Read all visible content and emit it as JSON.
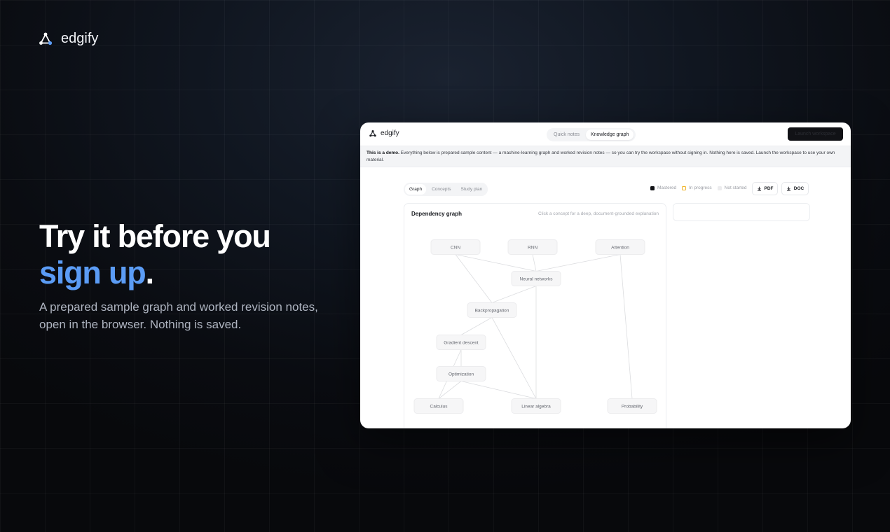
{
  "brand": {
    "name": "edgify"
  },
  "hero": {
    "title_line1": "Try it before you",
    "title_accent": "sign up",
    "title_period": ".",
    "subtitle": "A prepared sample graph and worked revision notes, open in the browser. Nothing is saved."
  },
  "demo": {
    "brand": "edgify",
    "tabs": [
      {
        "label": "Quick notes",
        "active": false
      },
      {
        "label": "Knowledge graph",
        "active": true
      }
    ],
    "launch_label": "Launch workspace",
    "banner_bold": "This is a demo.",
    "banner_text": "Everything below is prepared sample content — a machine-learning graph and worked revision notes — so you can try the workspace without signing in. Nothing here is saved. Launch the workspace to use your own material.",
    "subtabs": [
      {
        "label": "Graph",
        "active": true
      },
      {
        "label": "Concepts",
        "active": false
      },
      {
        "label": "Study plan",
        "active": false
      }
    ],
    "legend": [
      {
        "label": "Mastered",
        "color": "#111216"
      },
      {
        "label": "In progress",
        "color": "#f0b429"
      },
      {
        "label": "Not started",
        "color": "#ececee"
      }
    ],
    "export_buttons": [
      "PDF",
      "DOC"
    ],
    "panel_title": "Dependency graph",
    "panel_hint": "Click a concept for a deep, document-grounded explanation",
    "nodes": [
      {
        "id": "cnn",
        "label": "CNN"
      },
      {
        "id": "rnn",
        "label": "RNN"
      },
      {
        "id": "attention",
        "label": "Attention"
      },
      {
        "id": "neural_networks",
        "label": "Neural networks"
      },
      {
        "id": "backprop",
        "label": "Backpropagation"
      },
      {
        "id": "grad_descent",
        "label": "Gradient descent"
      },
      {
        "id": "optimization",
        "label": "Optimization"
      },
      {
        "id": "calculus",
        "label": "Calculus"
      },
      {
        "id": "linear_algebra",
        "label": "Linear algebra"
      },
      {
        "id": "probability",
        "label": "Probability"
      }
    ],
    "edges": [
      [
        "cnn",
        "neural_networks"
      ],
      [
        "rnn",
        "neural_networks"
      ],
      [
        "attention",
        "neural_networks"
      ],
      [
        "cnn",
        "backprop"
      ],
      [
        "attention",
        "probability"
      ],
      [
        "neural_networks",
        "linear_algebra"
      ],
      [
        "neural_networks",
        "backprop"
      ],
      [
        "backprop",
        "grad_descent"
      ],
      [
        "backprop",
        "linear_algebra"
      ],
      [
        "grad_descent",
        "optimization"
      ],
      [
        "optimization",
        "calculus"
      ],
      [
        "optimization",
        "linear_algebra"
      ],
      [
        "grad_descent",
        "calculus"
      ]
    ]
  }
}
